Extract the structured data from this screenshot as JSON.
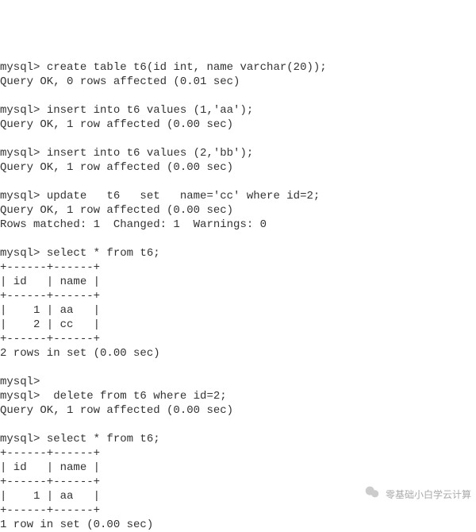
{
  "prompt": "mysql> ",
  "cmd1": "create table t6(id int, name varchar(20));",
  "resp1": "Query OK, 0 rows affected (0.01 sec)",
  "cmd2": "insert into t6 values (1,'aa');",
  "resp2": "Query OK, 1 row affected (0.00 sec)",
  "cmd3": "insert into t6 values (2,'bb');",
  "resp3": "Query OK, 1 row affected (0.00 sec)",
  "cmd4": "update   t6   set   name='cc' where id=2;",
  "resp4a": "Query OK, 1 row affected (0.00 sec)",
  "resp4b": "Rows matched: 1  Changed: 1  Warnings: 0",
  "cmd5": "select * from t6;",
  "tblSep": "+------+------+",
  "tblHead": "| id   | name |",
  "row1": "|    1 | aa   |",
  "row2": "|    2 | cc   |",
  "resp5": "2 rows in set (0.00 sec)",
  "cmd6": "",
  "cmd7": " delete from t6 where id=2;",
  "resp7": "Query OK, 1 row affected (0.00 sec)",
  "cmd8": "select * from t6;",
  "resp8": "1 row in set (0.00 sec)",
  "watermark": "零基础小白学云计算"
}
